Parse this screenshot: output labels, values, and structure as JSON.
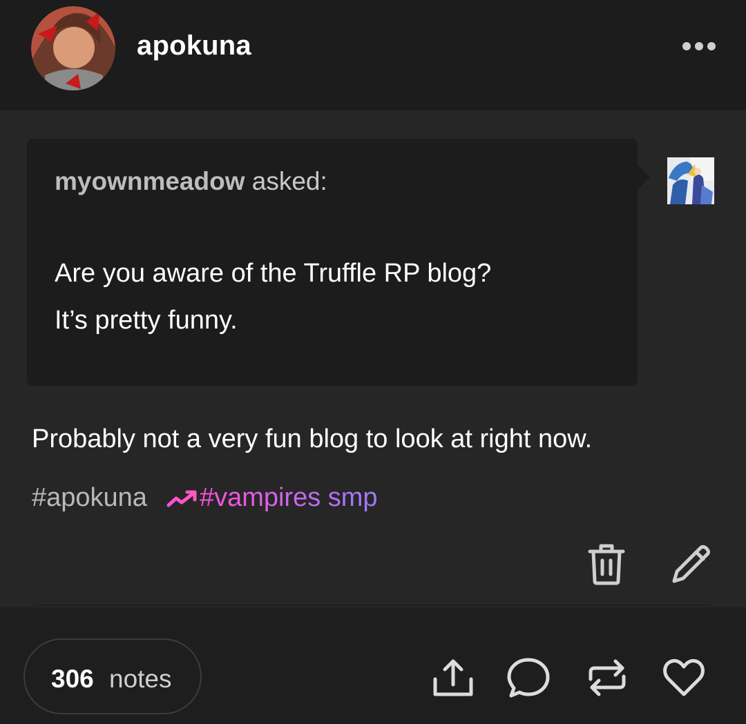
{
  "post": {
    "username": "apokuna",
    "avatar_icon": "user-avatar",
    "more_icon": "more-options-icon",
    "ask": {
      "asker": "myownmeadow",
      "asked_label": "asked:",
      "question_line1": "Are you aware of the Truffle RP blog?",
      "question_line2": "It’s pretty funny.",
      "asker_avatar_icon": "asker-avatar"
    },
    "answer": "Probably not a very fun blog to look at right now.",
    "tags": {
      "plain": "#apokuna",
      "trending": "#vampires smp",
      "trending_icon": "trending-icon"
    },
    "edit_actions": [
      "trash-icon",
      "pencil-icon"
    ]
  },
  "footer": {
    "notes_count": "306",
    "notes_label": "notes",
    "actions": [
      "share-icon",
      "reply-icon",
      "reblog-icon",
      "like-icon"
    ]
  },
  "colors": {
    "background": "#1e1e1e",
    "post_background": "#262626",
    "ask_background": "#1c1c1c",
    "trending_gradient_start": "#ff4fd8",
    "trending_gradient_end": "#9a7bff"
  }
}
